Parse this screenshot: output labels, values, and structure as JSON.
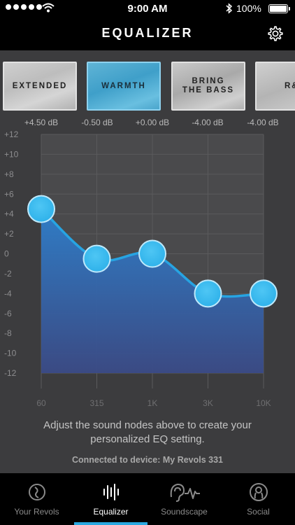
{
  "status_bar": {
    "time": "9:00 AM",
    "battery_percent": "100%",
    "signal_dots": 5,
    "icons": [
      "wifi-icon",
      "bluetooth-icon",
      "battery-icon"
    ]
  },
  "header": {
    "title": "EQUALIZER",
    "settings_icon": "gear-icon"
  },
  "presets": [
    {
      "lines": [
        "EXTENDED"
      ],
      "db": "+4.50 dB",
      "selected": false
    },
    {
      "lines": [
        "WARMTH"
      ],
      "db": "-0.50 dB",
      "selected": true
    },
    {
      "lines": [
        "BRING",
        "THE BASS"
      ],
      "db": "+0.00 dB",
      "selected": false
    },
    {
      "lines": [
        "R&"
      ],
      "db": "-4.00 dB",
      "selected": false
    }
  ],
  "extra_db": "-4.00 dB",
  "chart_data": {
    "type": "line",
    "y_ticks": [
      "+12",
      "+10",
      "+8",
      "+6",
      "+4",
      "+2",
      "0",
      "-2",
      "-4",
      "-6",
      "-8",
      "-10",
      "-12"
    ],
    "x_ticks": [
      "60",
      "315",
      "1K",
      "3K",
      "10K"
    ],
    "ylim": [
      -12,
      12
    ],
    "values": [
      4.5,
      -0.5,
      0.0,
      -4.0,
      -4.0
    ],
    "grid": true,
    "colors": {
      "node": "#2fb2ea",
      "node_edge": "#bfe9fb",
      "line": "#27a4e2",
      "fill_top": "#2e7fcc",
      "fill_bottom": "#3a4a86",
      "grid": "#5a5a5c"
    }
  },
  "caption": "Adjust the sound nodes above to create your personalized EQ setting.",
  "device": "Connected to device: My Revols 331",
  "tabs": [
    {
      "label": "Your Revols",
      "icon": "revols-icon",
      "active": false
    },
    {
      "label": "Equalizer",
      "icon": "equalizer-icon",
      "active": true
    },
    {
      "label": "Soundscape",
      "icon": "soundscape-icon",
      "active": false
    },
    {
      "label": "Social",
      "icon": "social-icon",
      "active": false
    }
  ],
  "accent_color": "#29a8e0"
}
